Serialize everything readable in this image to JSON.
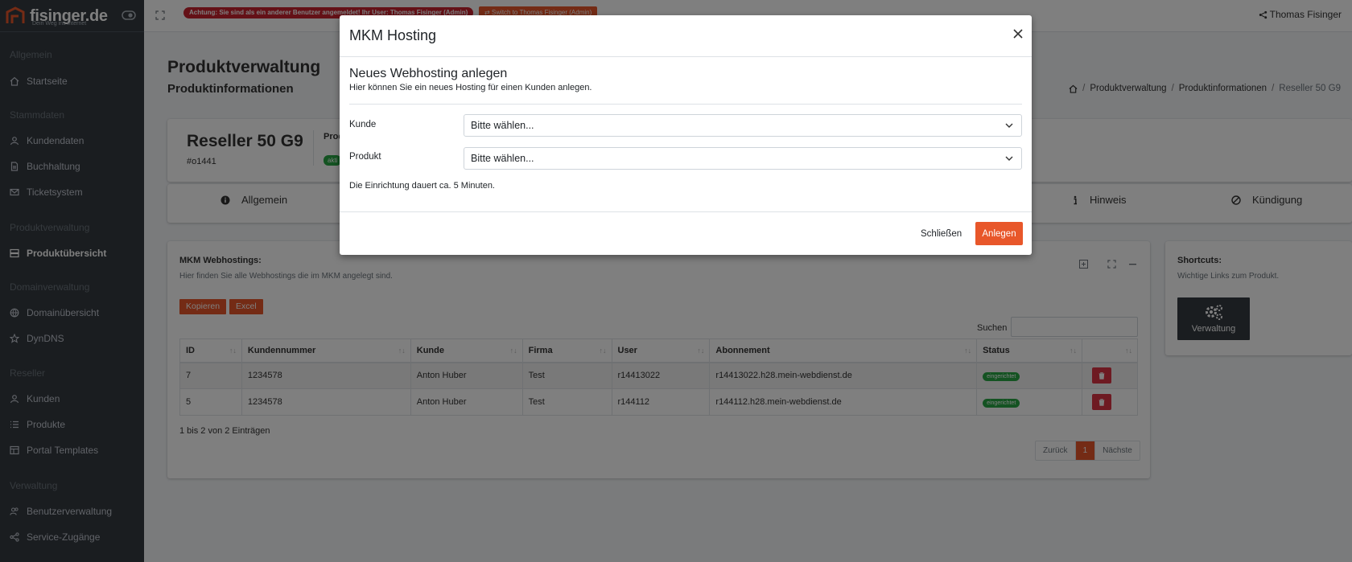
{
  "brand": {
    "name": "fisinger.de",
    "tagline": "Dein Weg ins Internet"
  },
  "sidebar": {
    "headers": [
      "Allgemein",
      "Stammdaten",
      "Produktverwaltung",
      "Domainverwaltung",
      "Reseller",
      "Verwaltung"
    ],
    "items": [
      {
        "label": "Startseite",
        "icon": "home-icon"
      },
      {
        "label": "Kundendaten",
        "icon": "user-icon"
      },
      {
        "label": "Buchhaltung",
        "icon": "document-icon"
      },
      {
        "label": "Ticketsystem",
        "icon": "mail-icon"
      },
      {
        "label": "Produktübersicht",
        "icon": "server-icon",
        "active": true
      },
      {
        "label": "Domainübersicht",
        "icon": "globe-icon"
      },
      {
        "label": "DynDNS",
        "icon": "star-icon"
      },
      {
        "label": "Kunden",
        "icon": "user-icon"
      },
      {
        "label": "Produkte",
        "icon": "list-icon"
      },
      {
        "label": "Portal Templates",
        "icon": "template-icon"
      },
      {
        "label": "Benutzerverwaltung",
        "icon": "users-icon"
      },
      {
        "label": "Service-Zugänge",
        "icon": "share-icon"
      }
    ]
  },
  "topbar": {
    "warning": "Achtung: Sie sind als ein anderer Benutzer angemeldet! Ihr User: Thomas Fisinger (Admin)",
    "switch_label": "⇄ Switch to Thomas Fisinger (Admin)",
    "user_name": "Thomas Fisinger"
  },
  "page": {
    "title": "Produktverwaltung",
    "subtitle": "Produktinformationen",
    "breadcrumb": [
      "Produktverwaltung",
      "Produktinformationen",
      "Reseller 50 G9"
    ]
  },
  "product": {
    "name": "Reseller 50 G9",
    "id": "#o1441",
    "label": "Prod",
    "badge": "akti"
  },
  "tabs": [
    {
      "label": "Allgemein",
      "icon": "info-circle-icon"
    },
    {
      "label": "Hinweis",
      "icon": "info-icon"
    },
    {
      "label": "Kündigung",
      "icon": "ban-icon"
    }
  ],
  "webhostings": {
    "title": "MKM Webhostings:",
    "subtitle": "Hier finden Sie alle Webhostings die im MKM angelegt sind.",
    "buttons": {
      "copy": "Kopieren",
      "excel": "Excel"
    },
    "search_label": "Suchen",
    "columns": [
      "ID",
      "Kundennummer",
      "Kunde",
      "Firma",
      "User",
      "Abonnement",
      "Status",
      ""
    ],
    "rows": [
      {
        "id": "7",
        "kundennummer": "1234578",
        "kunde": "Anton Huber",
        "firma": "Test",
        "user": "r14413022",
        "abonnement": "r14413022.h28.mein-webdienst.de",
        "status": "eingerichtet"
      },
      {
        "id": "5",
        "kundennummer": "1234578",
        "kunde": "Anton Huber",
        "firma": "Test",
        "user": "r144112",
        "abonnement": "r144112.h28.mein-webdienst.de",
        "status": "eingerichtet"
      }
    ],
    "info": "1 bis 2 von 2 Einträgen",
    "pager": {
      "prev": "Zurück",
      "page": "1",
      "next": "Nächste"
    }
  },
  "shortcuts": {
    "title": "Shortcuts:",
    "subtitle": "Wichtige Links zum Produkt.",
    "tile": "Verwaltung"
  },
  "modal": {
    "title": "MKM Hosting",
    "heading": "Neues Webhosting anlegen",
    "description": "Hier können Sie ein neues Hosting für einen Kunden anlegen.",
    "fields": [
      {
        "label": "Kunde",
        "value": "Bitte wählen..."
      },
      {
        "label": "Produkt",
        "value": "Bitte wählen..."
      }
    ],
    "note": "Die Einrichtung dauert ca. 5 Minuten.",
    "cancel": "Schließen",
    "submit": "Anlegen"
  },
  "colors": {
    "accent": "#e8572a",
    "sidebar": "#343a40",
    "success": "#28a745",
    "danger": "#dc3545",
    "warning": "#c8232f"
  }
}
